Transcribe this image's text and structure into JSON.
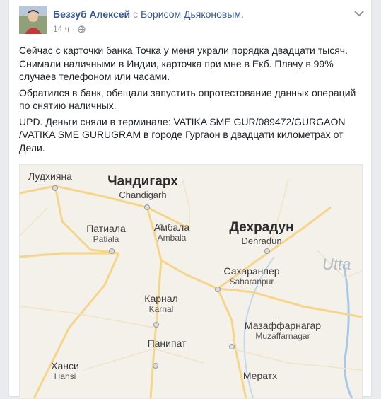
{
  "post": {
    "author": "Беззуб Алексей",
    "with_text": "с",
    "tagged": "Борисом Дьяконовым.",
    "time": "14 ч",
    "separator": "·",
    "privacy_icon": "globe-icon",
    "menu_icon": "chevron-down-icon",
    "paragraphs": [
      "Сейчас с карточки банка Точка у меня украли порядка двадцати тысяч. Снимали наличными в Индии, карточка при мне в Екб. Плачу в 99% случаев телефоном или часами.",
      "Обратился в банк, обещали запустить опротестование данных операций по снятию наличных.",
      "UPD. Деньги сняли в терминале: VATIKA SME GUR/089472/GURGAON /VATIKA SME GURUGRAM в городе Гургаон в двадцати километрах от Дели."
    ]
  },
  "map": {
    "cities": [
      {
        "id": "ludhiana",
        "ru": "Лудхияна",
        "en": ""
      },
      {
        "id": "chandigarh",
        "ru": "Чандигарх",
        "en": "Chandigarh"
      },
      {
        "id": "patiala",
        "ru": "Патиала",
        "en": "Patiala"
      },
      {
        "id": "ambala",
        "ru": "Амбала",
        "en": "Ambala"
      },
      {
        "id": "dehradun",
        "ru": "Дехрадун",
        "en": "Dehradun"
      },
      {
        "id": "saharanpur",
        "ru": "Сахаранпер",
        "en": "Saharanpur"
      },
      {
        "id": "karnal",
        "ru": "Карнал",
        "en": "Karnal"
      },
      {
        "id": "muzaffarnagar",
        "ru": "Мазаффарнагар",
        "en": "Muzaffarnagar"
      },
      {
        "id": "panipat",
        "ru": "Панипат",
        "en": ""
      },
      {
        "id": "hansi",
        "ru": "Ханси",
        "en": "Hansi"
      },
      {
        "id": "meerut",
        "ru": "Мератх",
        "en": ""
      }
    ],
    "region_label": "Utta",
    "colors": {
      "road": "#f5d58a",
      "water": "#a8c8e8",
      "land": "#f4f1ea"
    }
  }
}
